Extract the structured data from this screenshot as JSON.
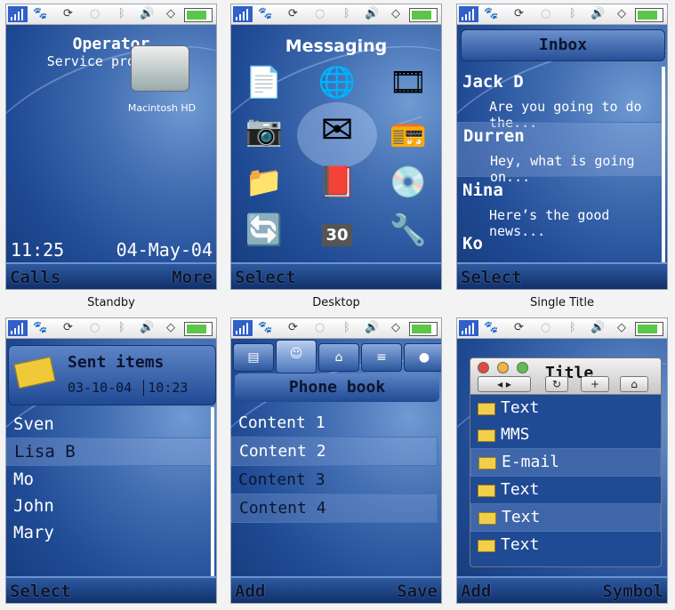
{
  "captions": [
    "Standby",
    "Desktop",
    "Single Title"
  ],
  "status_icons": [
    "signal-icon",
    "paw-icon",
    "sync-icon",
    "bubble-icon",
    "bluetooth-icon",
    "speaker-icon",
    "wifi-icon",
    "battery-icon"
  ],
  "standby": {
    "operator": "Operator",
    "provider": "Service provider",
    "disk_label": "Macintosh HD",
    "time": "11:25",
    "date": "04-May-04",
    "soft_left": "Calls",
    "soft_right": "More"
  },
  "desktop": {
    "title": "Messaging",
    "soft_left": "Select",
    "icons": [
      "documents-icon",
      "globe-phone-icon",
      "media-icon",
      "camera-icon",
      "envelope-icon",
      "radio-icon",
      "folder-icon",
      "book-icon",
      "music-disc-icon",
      "sync-phone-icon",
      "calendar-bell-icon",
      "wrench-icon"
    ],
    "calendar_day": "30"
  },
  "inbox": {
    "title": "Inbox",
    "soft_left": "Select",
    "messages": [
      {
        "name": "Jack D",
        "preview": "Are you going to do the..."
      },
      {
        "name": "Durren",
        "preview": "Hey, what is going on..."
      },
      {
        "name": "Nina",
        "preview": "Here’s the good news..."
      },
      {
        "name": "Ko",
        "preview": ""
      }
    ]
  },
  "sent": {
    "title": "Sent items",
    "date": "03-10-04",
    "time": "10:23",
    "soft_left": "Select",
    "items": [
      "Sven",
      "Lisa B",
      "Mo",
      "John",
      "Mary"
    ]
  },
  "phonebook": {
    "title": "Phone book",
    "soft_left": "Add",
    "soft_right": "Save",
    "tabs": [
      "card-icon",
      "contact-icon",
      "house-icon",
      "note-icon",
      "globe-icon"
    ],
    "contents": [
      "Content 1",
      "Content 2",
      "Content 3",
      "Content 4"
    ]
  },
  "symbol": {
    "title": "Title",
    "soft_left": "Add",
    "soft_right": "Symbol",
    "toolbar": [
      "◂ ▸",
      "↻",
      "+",
      "⌂"
    ],
    "items": [
      "Text",
      "MMS",
      "E-mail",
      "Text",
      "Text",
      "Text"
    ]
  }
}
